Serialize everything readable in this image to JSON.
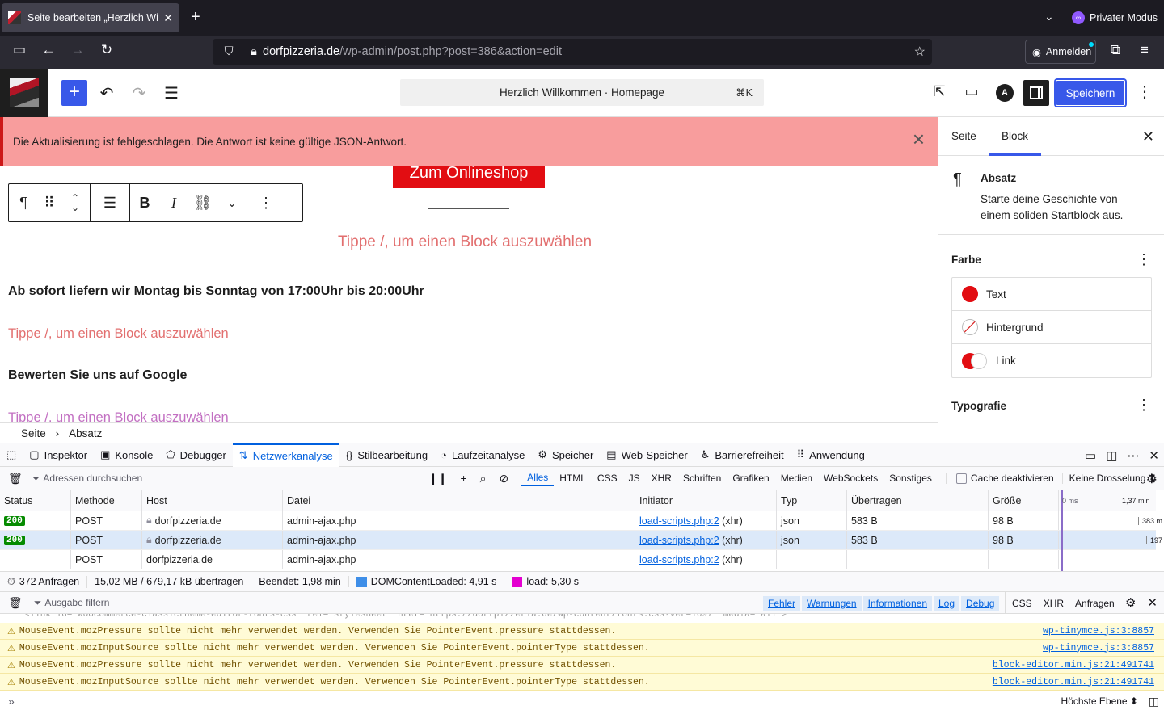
{
  "browser": {
    "tab_title": "Seite bearbeiten „Herzlich Willkommen",
    "new_tab": "+",
    "private_label": "Privater Modus",
    "url_host": "dorfpizzeria.de",
    "url_path": "/wp-admin/post.php?post=386&action=edit",
    "signin_label": "Anmelden"
  },
  "editor": {
    "add_symbol": "+",
    "command_title": "Herzlich Willkommen · Homepage",
    "command_shortcut": "⌘K",
    "save_label": "Speichern",
    "astra_letter": "A"
  },
  "notice": {
    "text": "Die Aktualisierung ist fehlgeschlagen. Die Antwort ist keine gültige JSON-Antwort."
  },
  "canvas": {
    "shop_button": "Zum Onlineshop",
    "placeholder_1": "Tippe /, um einen Block auszuwählen",
    "delivery_text": "Ab sofort liefern wir Montag bis Sonntag von 17:00Uhr bis 20:00Uhr",
    "placeholder_2": "Tippe /, um einen Block auszuwählen",
    "google_link": "Bewerten Sie uns auf Google",
    "placeholder_3": "Tippe /, um einen Block auszuwählen"
  },
  "breadcrumb": {
    "root": "Seite",
    "separator": "›",
    "current": "Absatz"
  },
  "sidebar": {
    "tab_page": "Seite",
    "tab_block": "Block",
    "block_name": "Absatz",
    "block_desc": "Starte deine Geschichte von einem soliden Startblock aus.",
    "color_heading": "Farbe",
    "color_items": [
      "Text",
      "Hintergrund",
      "Link"
    ],
    "text_color": "#e20d12",
    "typography_heading": "Typografie"
  },
  "devtools": {
    "tabs": [
      "Inspektor",
      "Konsole",
      "Debugger",
      "Netzwerkanalyse",
      "Stilbearbeitung",
      "Laufzeitanalyse",
      "Speicher",
      "Web-Speicher",
      "Barrierefreiheit",
      "Anwendung"
    ],
    "active_tab": "Netzwerkanalyse",
    "net_filter_placeholder": "Adressen durchsuchen",
    "type_filters": [
      "Alles",
      "HTML",
      "CSS",
      "JS",
      "XHR",
      "Schriften",
      "Grafiken",
      "Medien",
      "WebSockets",
      "Sonstiges"
    ],
    "cache_label": "Cache deaktivieren",
    "throttle_label": "Keine Drosselung ⬍",
    "columns": [
      "Status",
      "Methode",
      "Host",
      "Datei",
      "Initiator",
      "Typ",
      "Übertragen",
      "Größe"
    ],
    "waterfall_ticks": [
      "0 ms",
      "1,37 min"
    ],
    "rows": [
      {
        "status": "200",
        "method": "POST",
        "host": "dorfpizzeria.de",
        "file": "admin-ajax.php",
        "initiator": "load-scripts.php:2",
        "initiator_suffix": "(xhr)",
        "type": "json",
        "transferred": "583 B",
        "size": "98 B",
        "wf": "383 m"
      },
      {
        "status": "200",
        "method": "POST",
        "host": "dorfpizzeria.de",
        "file": "admin-ajax.php",
        "initiator": "load-scripts.php:2",
        "initiator_suffix": "(xhr)",
        "type": "json",
        "transferred": "583 B",
        "size": "98 B",
        "wf": "197"
      },
      {
        "status": "",
        "method": "POST",
        "host": "dorfpizzeria.de",
        "file": "admin-ajax.php",
        "initiator": "load-scripts.php:2",
        "initiator_suffix": "(xhr)",
        "type": "",
        "transferred": "",
        "size": "",
        "wf": ""
      }
    ],
    "summary": {
      "requests": "372 Anfragen",
      "transferred": "15,02 MB / 679,17 kB übertragen",
      "finished": "Beendet: 1,98 min",
      "dcl": "DOMContentLoaded: 4,91 s",
      "load": "load: 5,30 s",
      "dcl_color": "#3e8ee8",
      "load_color": "#e400d0"
    },
    "console": {
      "filter_placeholder": "Ausgabe filtern",
      "levels": [
        "Fehler",
        "Warnungen",
        "Informationen",
        "Log",
        "Debug"
      ],
      "extras": [
        "CSS",
        "XHR",
        "Anfragen"
      ],
      "scrolled_text": "<link id='woocommerce-classictheme-editor-fonts-css' rel='stylesheet' href='https://dorfpizzeria.de/wp-content/fonts.css?ver=1697' media='all'>",
      "messages": [
        {
          "text": "MouseEvent.mozPressure sollte nicht mehr verwendet werden. Verwenden Sie PointerEvent.pressure stattdessen.",
          "source": "wp-tinymce.js:3:8857"
        },
        {
          "text": "MouseEvent.mozInputSource sollte nicht mehr verwendet werden. Verwenden Sie PointerEvent.pointerType stattdessen.",
          "source": "wp-tinymce.js:3:8857"
        },
        {
          "text": "MouseEvent.mozPressure sollte nicht mehr verwendet werden. Verwenden Sie PointerEvent.pressure stattdessen.",
          "source": "block-editor.min.js:21:491741"
        },
        {
          "text": "MouseEvent.mozInputSource sollte nicht mehr verwendet werden. Verwenden Sie PointerEvent.pointerType stattdessen.",
          "source": "block-editor.min.js:21:491741"
        }
      ],
      "context_label": "Höchste Ebene ⬍"
    }
  }
}
